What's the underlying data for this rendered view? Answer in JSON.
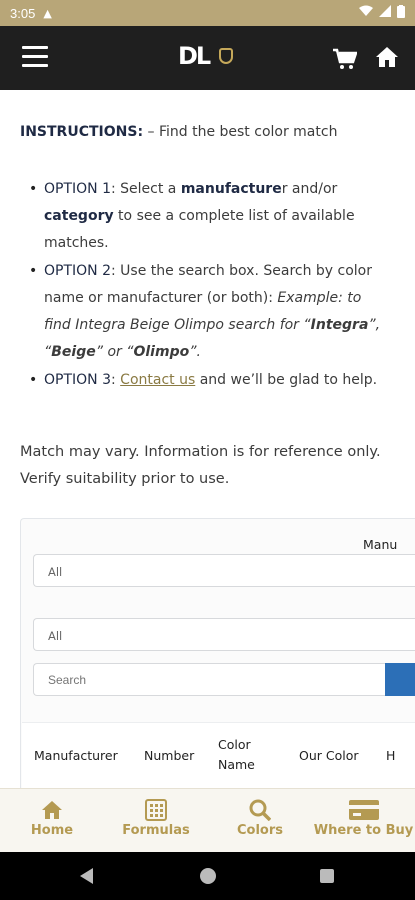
{
  "status": {
    "time": "3:05"
  },
  "header": {
    "logo_text": "DL",
    "icons": [
      "menu-icon",
      "cart-icon",
      "home-icon"
    ]
  },
  "instructions": {
    "label": "INSTRUCTIONS:",
    "text": " – Find the best color match"
  },
  "options": [
    {
      "label": "OPTION 1",
      "p1": ": Select a ",
      "kw1": "manufacture",
      "p2": "r and/or ",
      "kw2": "category",
      "p3": " to see a complete list of available matches."
    },
    {
      "label": "OPTION 2",
      "p1": ": Use the search box. Search by color name or manufacturer (or both): ",
      "example_intro": "Example: to find Integra Beige Olimpo search for “",
      "ex1": "Integra",
      "sep1": "”, “",
      "ex2": "Beige",
      "sep2": "” or “",
      "ex3": "Olimpo",
      "end": "”."
    },
    {
      "label": "OPTION 3",
      "p1": ": ",
      "link": "Contact us",
      "p2": " and we’ll be glad to help."
    }
  ],
  "disclaimer": "Match may vary. Information is for reference only. Verify suitability prior to use.",
  "filters": {
    "manufacturer_label": "Manu",
    "select1_value": "All",
    "select2_value": "All",
    "search_placeholder": "Search"
  },
  "table": {
    "headers": [
      "Manufacturer",
      "Number",
      "Color Name",
      "Our Color",
      "H"
    ]
  },
  "bottom_nav": {
    "items": [
      {
        "label": "Home",
        "icon": "home-icon"
      },
      {
        "label": "Formulas",
        "icon": "calculator-icon"
      },
      {
        "label": "Colors",
        "icon": "search-icon"
      },
      {
        "label": "Where to Buy",
        "icon": "credit-card-icon"
      }
    ]
  },
  "colors": {
    "status_bar": "#b8a678",
    "app_bar": "#1f1f1f",
    "accent_gold": "#b49a52",
    "search_button": "#2c6fb7"
  }
}
